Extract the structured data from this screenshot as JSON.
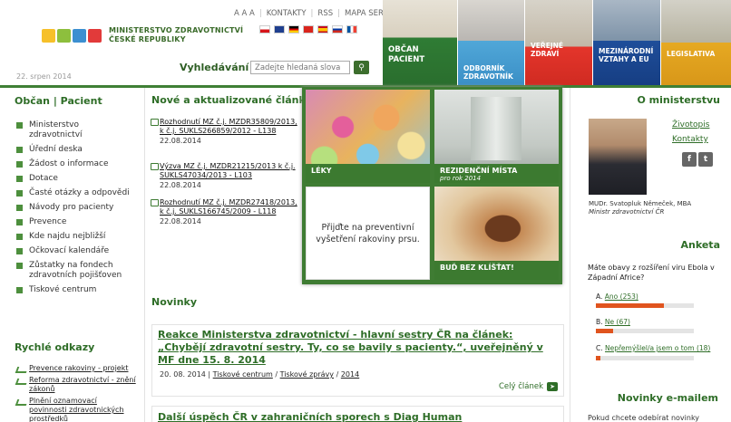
{
  "header": {
    "org_line1": "MINISTERSTVO ZDRAVOTNICTVÍ",
    "org_line2": "ČESKÉ REPUBLIKY",
    "logo_colors": [
      "#f6c02a",
      "#8dbf3d",
      "#3c8fd1",
      "#e23a3a",
      "#ffffff"
    ],
    "date": "22. srpen 2014",
    "util": {
      "font_sizes": "A A A",
      "contacts": "KONTAKTY",
      "rss": "RSS",
      "sitemap": "MAPA SERVERU"
    },
    "flags": [
      "cz",
      "gb",
      "de",
      "vn",
      "es",
      "ru",
      "fr"
    ],
    "search_label": "Vyhledávání",
    "search_placeholder": "Zadejte hledaná slova"
  },
  "nav": [
    {
      "label": "OBČAN PACIENT",
      "color": "#2f7c34"
    },
    {
      "label": "ODBORNÍK ZDRAVOTNÍK",
      "color": "#50a7d8"
    },
    {
      "label": "VEŘEJNÉ ZDRAVÍ",
      "color": "#e4352b"
    },
    {
      "label": "MEZINÁRODNÍ VZTAHY A EU",
      "color": "#1f4e9a"
    },
    {
      "label": "LEGISLATIVA",
      "color": "#e6a922"
    }
  ],
  "left": {
    "title": "Občan | Pacient",
    "items": [
      "Ministerstvo zdravotnictví",
      "Úřední deska",
      "Žádost o informace",
      "Dotace",
      "Časté otázky a odpovědi",
      "Návody pro pacienty",
      "Prevence",
      "Kde najdu nejbližší",
      "Očkovací kalendáře",
      "Zůstatky na fondech zdravotních pojišťoven",
      "Tiskové centrum"
    ],
    "quick_title": "Rychlé odkazy",
    "quick": [
      "Prevence rakoviny - projekt",
      "Reforma zdravotnictví - znění zákonů",
      "Plnění oznamovací povinnosti zdravotnických prostředků"
    ]
  },
  "center": {
    "articles_title": "Nové a aktualizované články",
    "articles": [
      {
        "title": "Rozhodnutí MZ č.j. MZDR35809/2013, k č.j. SUKLS266859/2012 - L138",
        "date": "22.08.2014"
      },
      {
        "title": "Výzva MZ č.j. MZDR21215/2013 k č.j. SUKLS47034/2013 - L103",
        "date": "22.08.2014"
      },
      {
        "title": "Rozhodnutí MZ č.j. MZDR27418/2013, k č.j. SUKLS166745/2009 - L118",
        "date": "22.08.2014"
      }
    ],
    "tiles": {
      "leky": "LÉKY",
      "rez": "REZIDENČNÍ MÍSTA",
      "rez_sub": "pro rok 2014",
      "prev": "Přijďte na preventivní vyšetření rakoviny prsu.",
      "klis": "BUĎ BEZ KLÍŠŤAT!"
    },
    "news_title": "Novinky",
    "news": [
      {
        "title": "Reakce Ministerstva zdravotnictví - hlavní sestry ČR na článek: „Chybějí zdravotní sestry. Ty, co se bavily s pacienty.“, uveřejněný v MF dne 15. 8. 2014",
        "date": "20. 08. 2014",
        "cat1": "Tiskové centrum",
        "cat2": "Tiskové zprávy",
        "year": "2014",
        "more": "Celý článek"
      },
      {
        "title": "Další úspěch ČR v zahraničních sporech s Diag Human"
      }
    ]
  },
  "right": {
    "title": "O ministerstvu",
    "bio": "Životopis",
    "contacts": "Kontakty",
    "fb": "f",
    "tw": "t",
    "minister_name": "MUDr. Svatopluk Němeček, MBA",
    "minister_role": "Ministr zdravotnictví ČR",
    "poll_title": "Anketa",
    "poll_q": "Máte obavy z rozšíření viru Ebola v Západní Africe?",
    "options": [
      {
        "letter": "A.",
        "label": "Ano (253)",
        "share": 0.69
      },
      {
        "letter": "B.",
        "label": "Ne (67)",
        "share": 0.18
      },
      {
        "letter": "C.",
        "label": "Nepřemýšlel/a jsem o tom (18)",
        "share": 0.05
      }
    ],
    "email_title": "Novinky e-mailem",
    "email_text": "Pokud chcete odebírat novinky"
  }
}
